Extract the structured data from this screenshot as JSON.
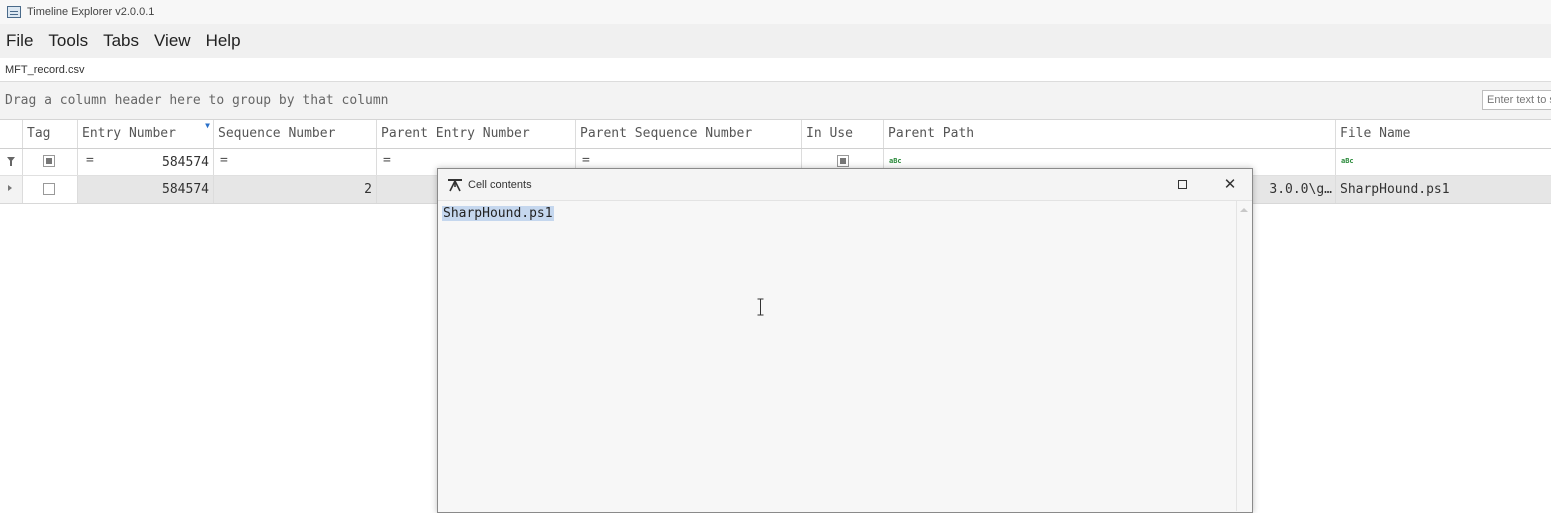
{
  "window": {
    "title": "Timeline Explorer v2.0.0.1"
  },
  "menu": [
    "File",
    "Tools",
    "Tabs",
    "View",
    "Help"
  ],
  "tab": {
    "label": "MFT_record.csv"
  },
  "grouping": {
    "hint": "Drag a column header here to group by that column"
  },
  "search": {
    "placeholder": "Enter text to search..."
  },
  "columns": [
    "Tag",
    "Entry Number",
    "Sequence Number",
    "Parent Entry Number",
    "Parent Sequence Number",
    "In Use",
    "Parent Path",
    "File Name"
  ],
  "filter": {
    "entry_number": "584574",
    "eq": "="
  },
  "row": {
    "entry_number": "584574",
    "sequence_number": "2",
    "parent_path_tail": "3.0.0\\g…",
    "file_name": "SharpHound.ps1"
  },
  "dialog": {
    "title": "Cell contents",
    "value": "SharpHound.ps1",
    "maximize_label": "",
    "close_label": "✕"
  }
}
